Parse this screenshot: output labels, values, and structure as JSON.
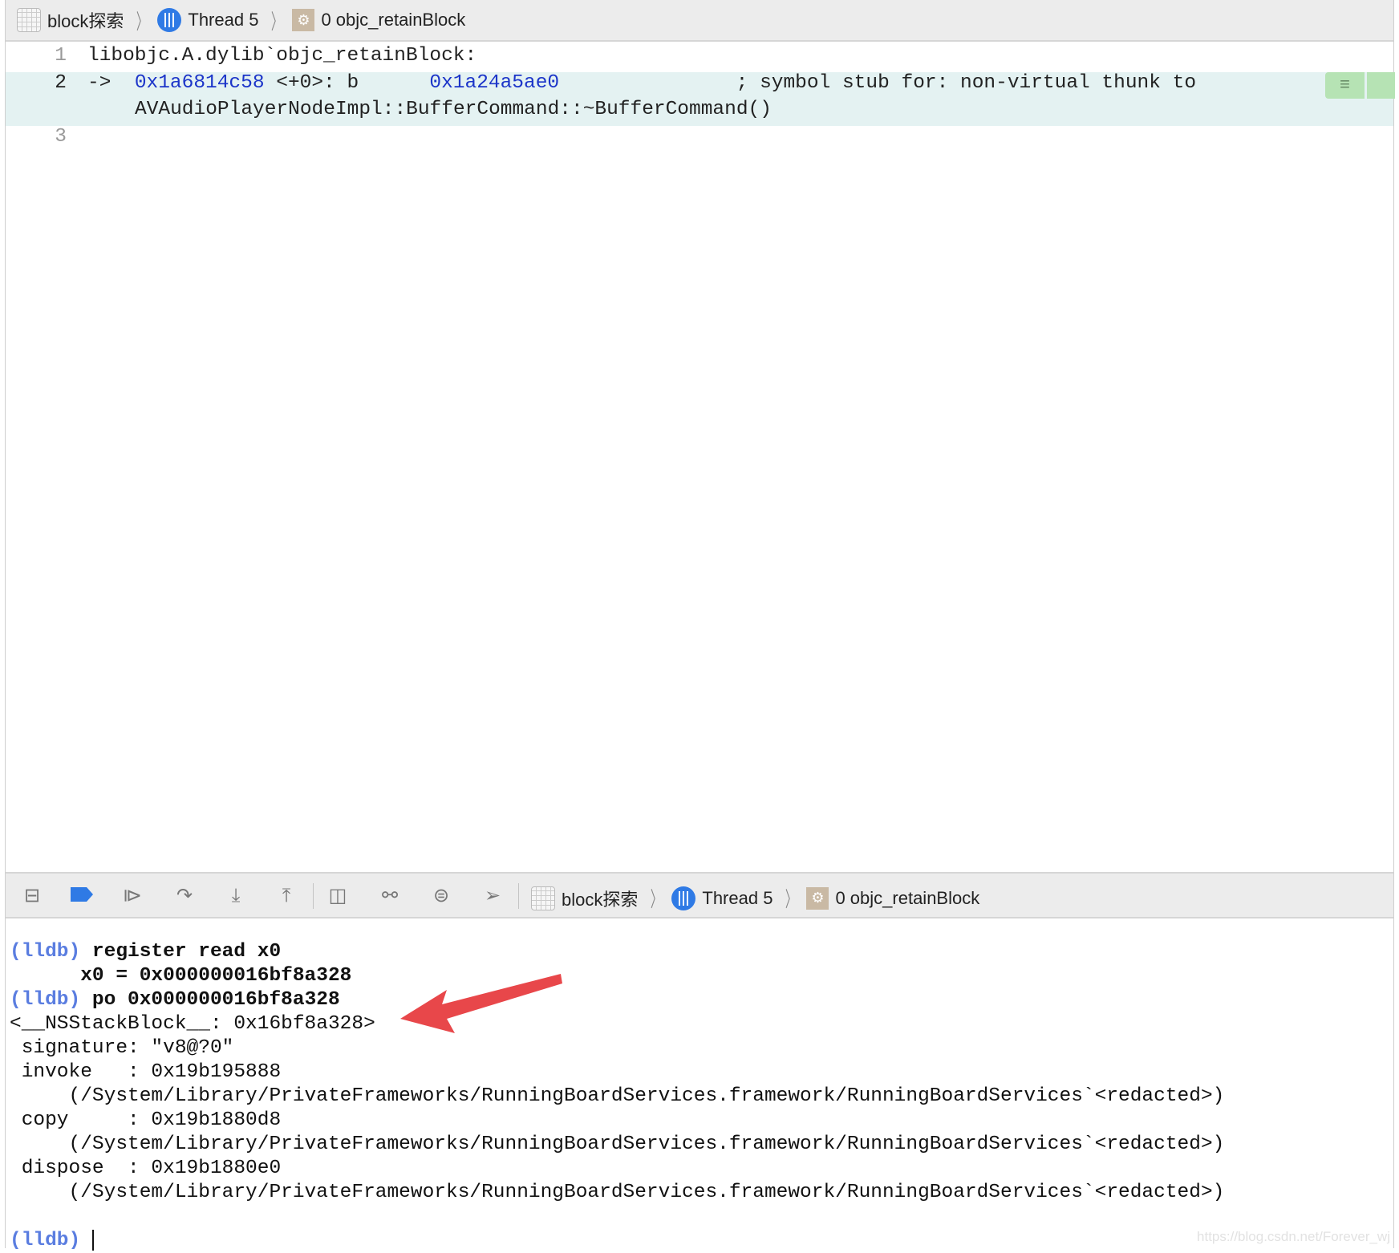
{
  "breadcrumb": {
    "project": "block探索",
    "thread": "Thread 5",
    "frame": "0 objc_retainBlock"
  },
  "editor": {
    "lines": [
      {
        "number": "1",
        "text": "libobjc.A.dylib`objc_retainBlock:"
      },
      {
        "number": "2",
        "arrow": "->",
        "address": "0x1a6814c58",
        "offset": " <+0>: b      ",
        "target": "0x1a24a5ae0",
        "comment": "               ; symbol stub for: non-virtual thunk to",
        "continuation": "AVAudioPlayerNodeImpl::BufferCommand::~BufferCommand()"
      },
      {
        "number": "3",
        "text": ""
      }
    ],
    "marker_icon": "≡"
  },
  "debug_bar": {
    "icons": [
      "hide-console-icon",
      "breakpoints-toggle-icon",
      "continue-icon",
      "step-over-icon",
      "step-into-icon",
      "step-out-icon",
      "view-hierarchy-icon",
      "memory-graph-icon",
      "environment-overrides-icon",
      "simulate-location-icon"
    ]
  },
  "console": {
    "prompt": "(lldb)",
    "lines": [
      {
        "prompt": "(lldb)",
        "cmd": " register read x0"
      },
      {
        "text": "      x0 = 0x000000016bf8a328",
        "bold": true
      },
      {
        "prompt": "(lldb)",
        "cmd": " po 0x000000016bf8a328"
      },
      {
        "text": "<__NSStackBlock__: 0x16bf8a328>"
      },
      {
        "text": " signature: \"v8@?0\""
      },
      {
        "text": " invoke   : 0x19b195888"
      },
      {
        "text": "     (/System/Library/PrivateFrameworks/RunningBoardServices.framework/RunningBoardServices`<redacted>)"
      },
      {
        "text": " copy     : 0x19b1880d8"
      },
      {
        "text": "     (/System/Library/PrivateFrameworks/RunningBoardServices.framework/RunningBoardServices`<redacted>)"
      },
      {
        "text": " dispose  : 0x19b1880e0"
      },
      {
        "text": "     (/System/Library/PrivateFrameworks/RunningBoardServices.framework/RunningBoardServices`<redacted>)"
      }
    ]
  },
  "annotation_color": "#e8474a",
  "watermark": "https://blog.csdn.net/Forever_wj"
}
